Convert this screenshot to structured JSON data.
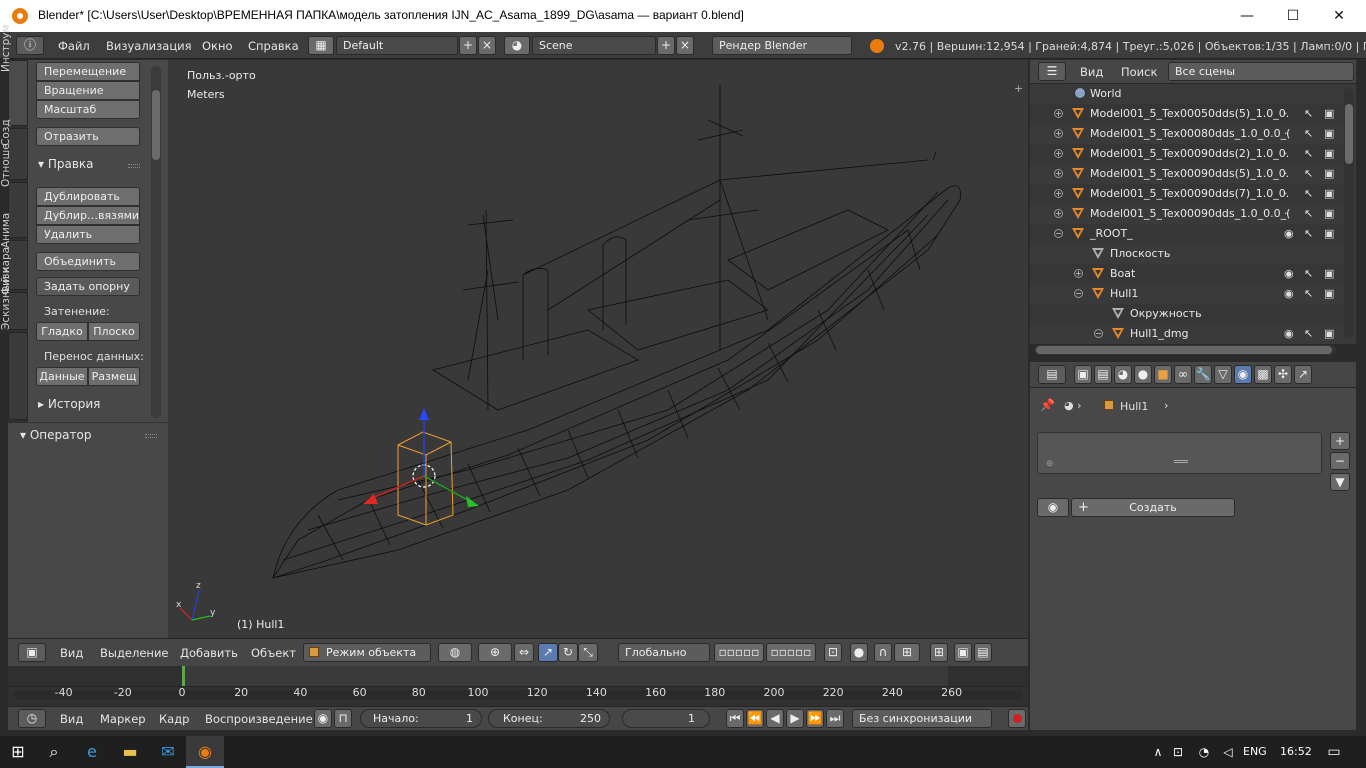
{
  "window": {
    "title": "Blender* [C:\\Users\\User\\Desktop\\ВРЕМЕННАЯ ПАПКА\\модель затопления IJN_AC_Asama_1899_DG\\asama — вариант 0.blend]",
    "minimize": "—",
    "maximize": "☐",
    "close": "✕"
  },
  "topbar": {
    "menus": [
      "Файл",
      "Визуализация",
      "Окно",
      "Справка"
    ],
    "layout": "Default",
    "scene": "Scene",
    "renderer": "Рендер Blender",
    "stats": "v2.76 | Вершин:12,954 | Граней:4,874 | Треуг.:5,026 | Объектов:1/35 | Ламп:0/0 | Пам.:"
  },
  "tabs": [
    "Инструм",
    "Созд",
    "Отноше",
    "Анима",
    "Физи",
    "Эскизный кара"
  ],
  "toolshelf": {
    "transform": [
      "Перемещение",
      "Вращение",
      "Масштаб"
    ],
    "mirror": "Отразить",
    "edit_header": "Правка",
    "edit": [
      "Дублировать",
      "Дублир…вязями",
      "Удалить"
    ],
    "join": "Объединить",
    "set_origin": "Задать опорну",
    "shading_label": "Затенение:",
    "smooth": "Гладко",
    "flat": "Плоско",
    "data_transfer_label": "Перенос данных:",
    "data": "Данные",
    "layout": "Размещ",
    "history": "История",
    "operator": "Оператор"
  },
  "viewport": {
    "view_name": "Польз.-орто",
    "units": "Meters",
    "object_label": "(1) Hull1",
    "axis_x": "x",
    "axis_y": "y",
    "axis_z": "z"
  },
  "viewport_header": {
    "menus": [
      "Вид",
      "Выделение",
      "Добавить",
      "Объект"
    ],
    "mode": "Режим объекта",
    "orientation": "Глобально"
  },
  "timeline": {
    "ticks": [
      "-40",
      "-20",
      "0",
      "20",
      "40",
      "60",
      "80",
      "100",
      "120",
      "140",
      "160",
      "180",
      "200",
      "220",
      "240",
      "260"
    ],
    "current_frame_value": 1,
    "menus": [
      "Вид",
      "Маркер",
      "Кадр",
      "Воспроизведение"
    ],
    "start_label": "Начало:",
    "start_value": "1",
    "end_label": "Конец:",
    "end_value": "250",
    "current": "1",
    "sync": "Без синхронизации"
  },
  "outliner": {
    "menus": [
      "Вид",
      "Поиск"
    ],
    "filter": "Все сцены",
    "rows": [
      {
        "name": "World"
      },
      {
        "name": "Model001_5_Tex00050dds(5)_1.0_0."
      },
      {
        "name": "Model001_5_Tex00080dds_1.0_0.0_("
      },
      {
        "name": "Model001_5_Tex00090dds(2)_1.0_0."
      },
      {
        "name": "Model001_5_Tex00090dds(5)_1.0_0."
      },
      {
        "name": "Model001_5_Tex00090dds(7)_1.0_0."
      },
      {
        "name": "Model001_5_Tex00090dds_1.0_0.0_("
      },
      {
        "name": "_ROOT_"
      },
      {
        "name": "Плоскость"
      },
      {
        "name": "Boat"
      },
      {
        "name": "Hull1"
      },
      {
        "name": "Окружность"
      },
      {
        "name": "Hull1_dmg"
      }
    ]
  },
  "properties": {
    "breadcrumb": "Hull1",
    "create": "Создать"
  },
  "taskbar": {
    "lang": "ENG",
    "time": "16:52"
  }
}
